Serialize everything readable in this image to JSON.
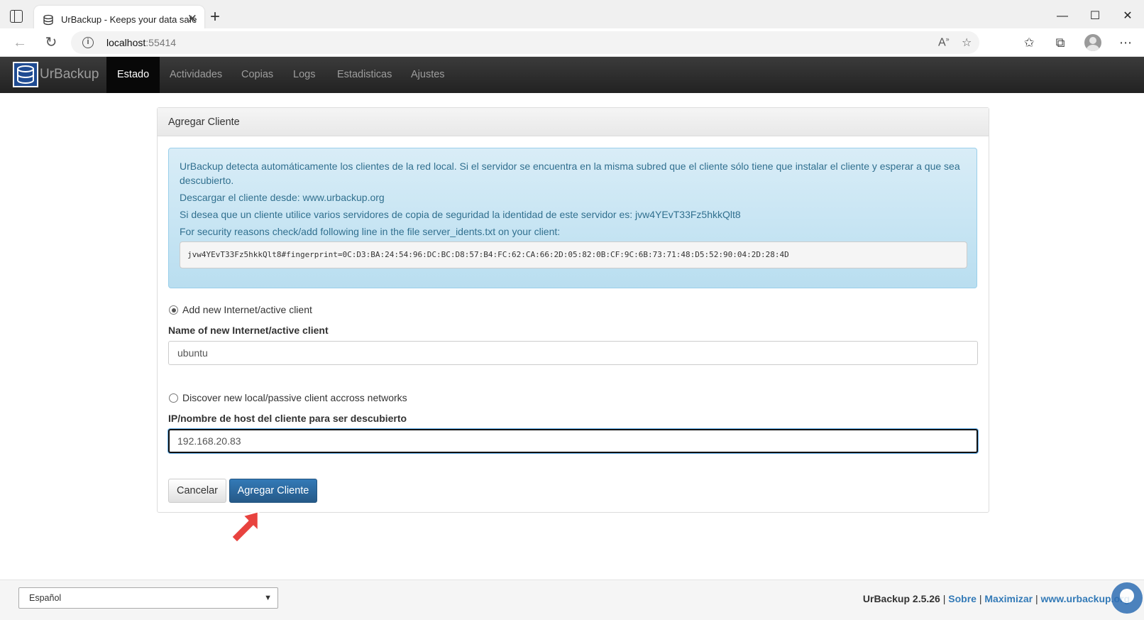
{
  "browser": {
    "tab_title": "UrBackup - Keeps your data safe",
    "tab_close": "✕",
    "new_tab": "+",
    "url_host": "localhost",
    "url_port": ":55414",
    "window_minimize": "—",
    "window_maximize": "☐",
    "window_close": "✕"
  },
  "navbar": {
    "brand": "UrBackup",
    "items": [
      {
        "label": "Estado",
        "active": true
      },
      {
        "label": "Actividades",
        "active": false
      },
      {
        "label": "Copias",
        "active": false
      },
      {
        "label": "Logs",
        "active": false
      },
      {
        "label": "Estadisticas",
        "active": false
      },
      {
        "label": "Ajustes",
        "active": false
      }
    ]
  },
  "panel": {
    "title": "Agregar Cliente",
    "info_text_1": "UrBackup detecta automáticamente los clientes de la red local. Si el servidor se encuentra en la misma subred que el cliente sólo tiene que instalar el cliente y esperar a que sea descubierto.",
    "info_text_2": "Descargar el cliente desde: www.urbackup.org",
    "info_text_3": "Si desea que un cliente utilice varios servidores de copia de seguridad la identidad de este servidor es: jvw4YEvT33Fz5hkkQlt8",
    "info_text_4": "For security reasons check/add following line in the file server_idents.txt on your client:",
    "fingerprint": "jvw4YEvT33Fz5hkkQlt8#fingerprint=0C:D3:BA:24:54:96:DC:BC:D8:57:B4:FC:62:CA:66:2D:05:82:0B:CF:9C:6B:73:71:48:D5:52:90:04:2D:28:4D",
    "option_internet": {
      "label": "Add new Internet/active client",
      "checked": true,
      "field_label": "Name of new Internet/active client",
      "value": "ubuntu"
    },
    "option_local": {
      "label": "Discover new local/passive client accross networks",
      "checked": false,
      "field_label": "IP/nombre de host del cliente para ser descubierto",
      "value": "192.168.20.83"
    },
    "cancel_label": "Cancelar",
    "submit_label": "Agregar Cliente"
  },
  "footer": {
    "language": "Español",
    "version": "UrBackup 2.5.26",
    "separator": " | ",
    "link_about": "Sobre",
    "link_maximize": "Maximizar",
    "link_site": "www.urbackup.org"
  },
  "colors": {
    "navbar": "#222222",
    "primary": "#337ab7",
    "alert_text": "#31708f",
    "alert_bg": "#d9edf7",
    "arrow": "#e8433f"
  }
}
